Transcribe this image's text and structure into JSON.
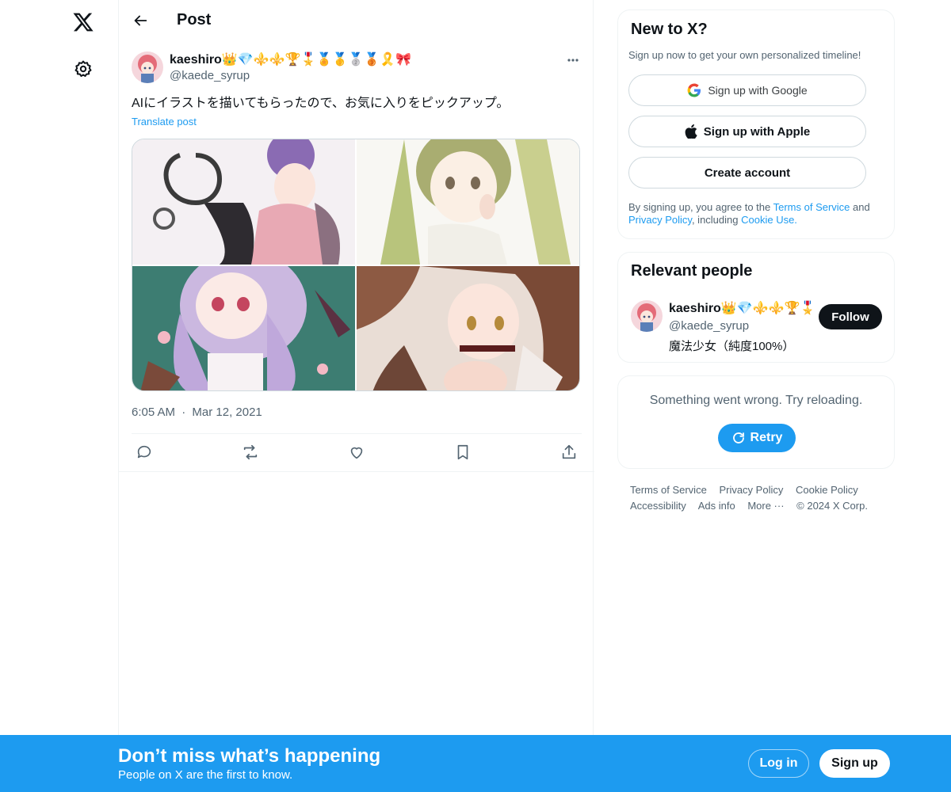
{
  "nav": {
    "logo": "x-logo-icon",
    "settings": "gear-icon"
  },
  "header": {
    "title": "Post"
  },
  "post": {
    "author_name": "kaeshiro👑💎⚜️⚜️🏆🎖️🏅🥇🥈🥉🎗️🎀",
    "author_handle": "@kaede_syrup",
    "text": "AIにイラストを描いてもらったので、お気に入りをピックアップ。",
    "translate_label": "Translate post",
    "time": "6:05 AM",
    "separator": "·",
    "date": "Mar 12, 2021",
    "actions": [
      "reply-icon",
      "repost-icon",
      "like-icon",
      "bookmark-icon",
      "share-icon"
    ]
  },
  "signup_card": {
    "title": "New to X?",
    "subtitle": "Sign up now to get your own personalized timeline!",
    "google_label": "Sign up with Google",
    "apple_label": "Sign up with Apple",
    "create_label": "Create account",
    "terms_prefix": "By signing up, you agree to the ",
    "terms_link": "Terms of Service",
    "terms_and": " and",
    "privacy_link": "Privacy Policy",
    "including": ", including ",
    "cookie_link": "Cookie Use."
  },
  "relevant": {
    "title": "Relevant people",
    "name": "kaeshiro👑💎⚜️⚜️🏆🎖️",
    "handle": "@kaede_syrup",
    "bio": "魔法少女（純度100%）",
    "follow_label": "Follow"
  },
  "error_card": {
    "message": "Something went wrong. Try reloading.",
    "retry_label": "Retry"
  },
  "footer": {
    "links": [
      "Terms of Service",
      "Privacy Policy",
      "Cookie Policy",
      "Accessibility",
      "Ads info",
      "More ···"
    ],
    "copyright": "© 2024 X Corp."
  },
  "banner": {
    "title": "Don’t miss what’s happening",
    "subtitle": "People on X are the first to know.",
    "login_label": "Log in",
    "signup_label": "Sign up"
  },
  "colors": {
    "accent": "#1d9bf0",
    "text": "#0f1419",
    "muted": "#536471",
    "border": "#eff3f4"
  }
}
